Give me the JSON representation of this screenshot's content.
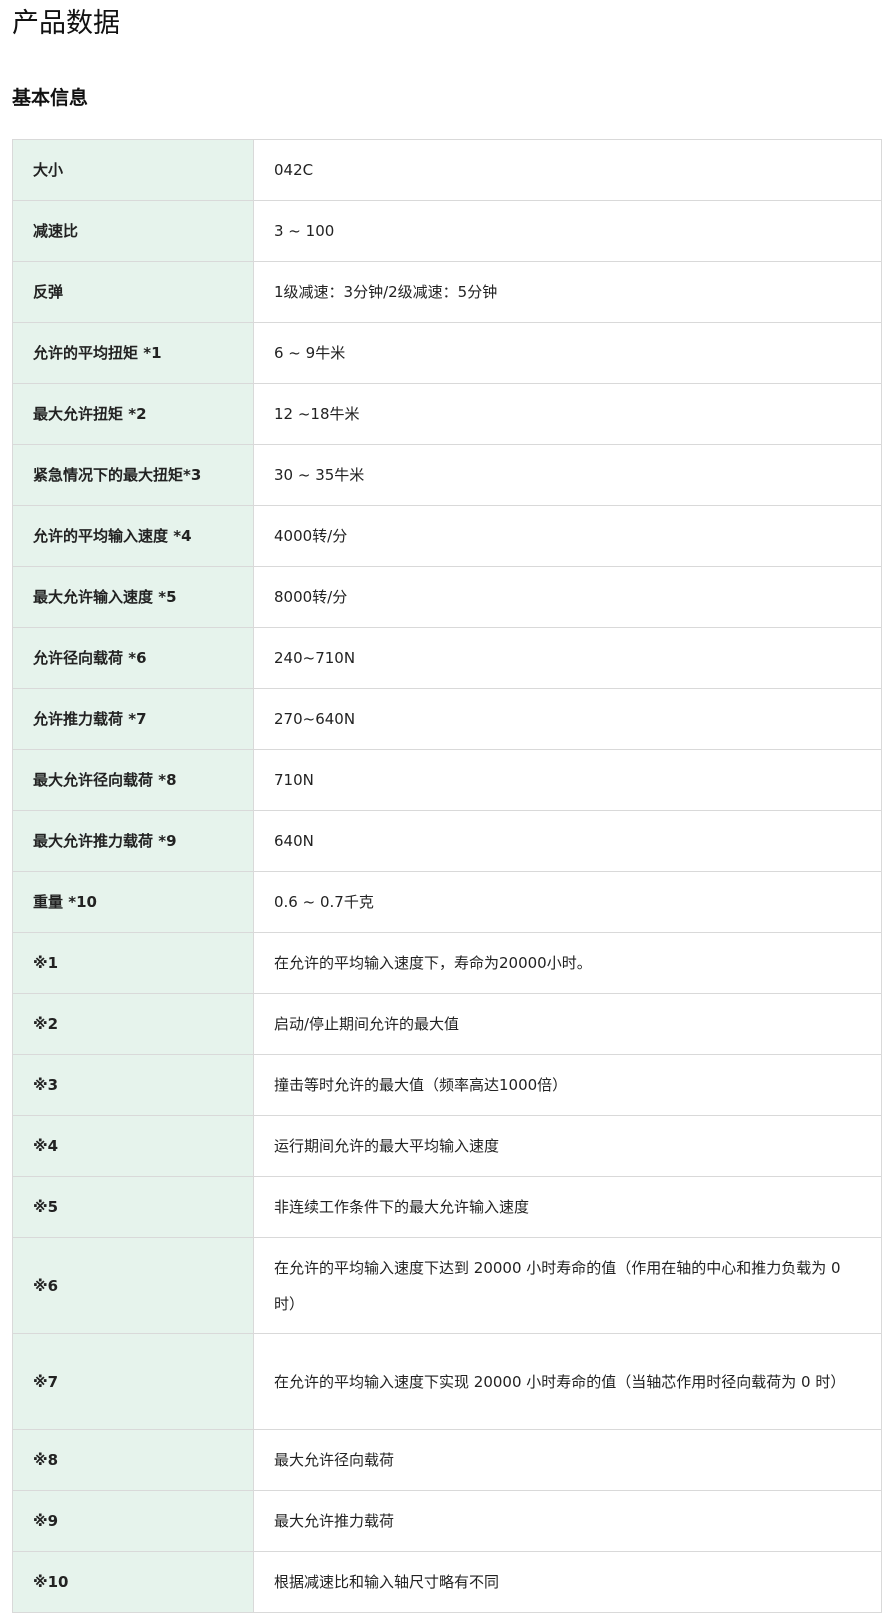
{
  "page": {
    "title": "产品数据",
    "section_title": "基本信息"
  },
  "colors": {
    "label_background": "#e6f3ec",
    "border": "#d9d9d9"
  },
  "specs": [
    {
      "label": "大小",
      "value": "042C"
    },
    {
      "label": "减速比",
      "value": "3 ~ 100"
    },
    {
      "label": "反弹",
      "value": "1级减速：3分钟/2级减速：5分钟"
    },
    {
      "label": "允许的平均扭矩 *1",
      "value": "6 ~ 9牛米"
    },
    {
      "label": "最大允许扭矩 *2",
      "value": "12 ~18牛米"
    },
    {
      "label": "紧急情况下的最大扭矩*3",
      "value": "30 ~ 35牛米"
    },
    {
      "label": "允许的平均输入速度 *4",
      "value": "4000转/分"
    },
    {
      "label": "最大允许输入速度 *5",
      "value": "8000转/分"
    },
    {
      "label": "允许径向载荷 *6",
      "value": "240~710N"
    },
    {
      "label": "允许推力载荷 *7",
      "value": "270~640N"
    },
    {
      "label": "最大允许径向载荷 *8",
      "value": "710N"
    },
    {
      "label": "最大允许推力载荷 *9",
      "value": "640N"
    },
    {
      "label": "重量 *10",
      "value": "0.6 ~ 0.7千克"
    },
    {
      "label": "※1",
      "value": "在允许的平均输入速度下，寿命为20000小时。"
    },
    {
      "label": "※2",
      "value": "启动/停止期间允许的最大值"
    },
    {
      "label": "※3",
      "value": "撞击等时允许的最大值（频率高达1000倍）"
    },
    {
      "label": "※4",
      "value": "运行期间允许的最大平均输入速度"
    },
    {
      "label": "※5",
      "value": "非连续工作条件下的最大允许输入速度"
    },
    {
      "label": "※6",
      "value": "在允许的平均输入速度下达到 20000 小时寿命的值（作用在轴的中心和推力负载为 0 时）"
    },
    {
      "label": "※7",
      "value": "在允许的平均输入速度下实现 20000 小时寿命的值（当轴芯作用时径向载荷为 0 时）"
    },
    {
      "label": "※8",
      "value": "最大允许径向载荷"
    },
    {
      "label": "※9",
      "value": "最大允许推力载荷"
    },
    {
      "label": "※10",
      "value": "根据减速比和输入轴尺寸略有不同"
    }
  ]
}
